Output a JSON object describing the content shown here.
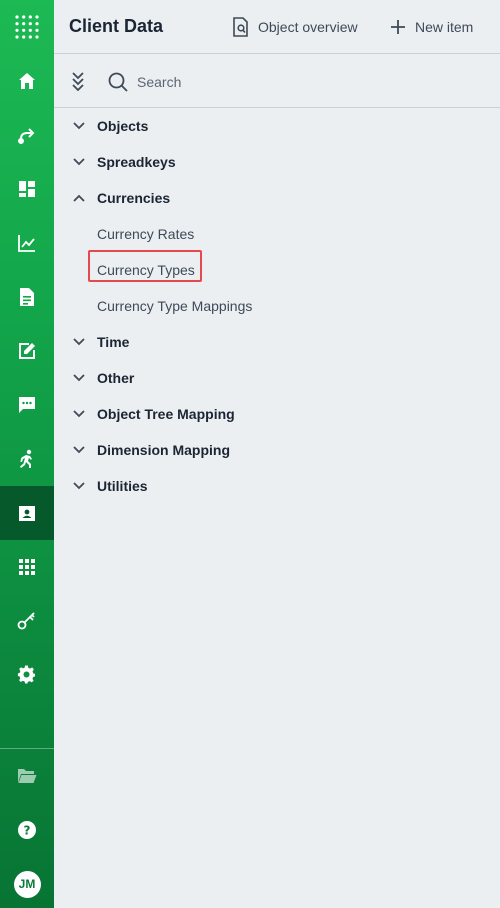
{
  "app": {
    "title": "Client Data"
  },
  "header": {
    "object_overview_label": "Object overview",
    "new_item_label": "New item"
  },
  "search": {
    "placeholder": "Search"
  },
  "rail": {
    "items": [
      {
        "name": "home-icon"
      },
      {
        "name": "workflow-icon"
      },
      {
        "name": "dashboard-icon"
      },
      {
        "name": "analytics-icon"
      },
      {
        "name": "report-icon"
      },
      {
        "name": "edit-document-icon"
      },
      {
        "name": "chat-icon"
      },
      {
        "name": "run-icon"
      },
      {
        "name": "client-data-icon",
        "active": true
      },
      {
        "name": "apps-grid-icon"
      },
      {
        "name": "key-icon"
      },
      {
        "name": "settings-icon"
      }
    ],
    "bottom": [
      {
        "name": "folder-icon"
      },
      {
        "name": "help-icon"
      }
    ],
    "user_initials": "JM"
  },
  "tree": {
    "nodes": [
      {
        "label": "Objects",
        "expanded": false
      },
      {
        "label": "Spreadkeys",
        "expanded": false
      },
      {
        "label": "Currencies",
        "expanded": true,
        "children": [
          {
            "label": "Currency Rates"
          },
          {
            "label": "Currency Types",
            "selected": true
          },
          {
            "label": "Currency Type Mappings"
          }
        ]
      },
      {
        "label": "Time",
        "expanded": false
      },
      {
        "label": "Other",
        "expanded": false
      },
      {
        "label": "Object Tree Mapping",
        "expanded": false
      },
      {
        "label": "Dimension Mapping",
        "expanded": false
      },
      {
        "label": "Utilities",
        "expanded": false
      }
    ]
  },
  "colors": {
    "rail_top": "#1db954",
    "rail_bottom": "#087434",
    "rail_active": "#06592a",
    "background": "#ebeff2",
    "text": "#1b2533",
    "highlight": "#e5484d"
  }
}
